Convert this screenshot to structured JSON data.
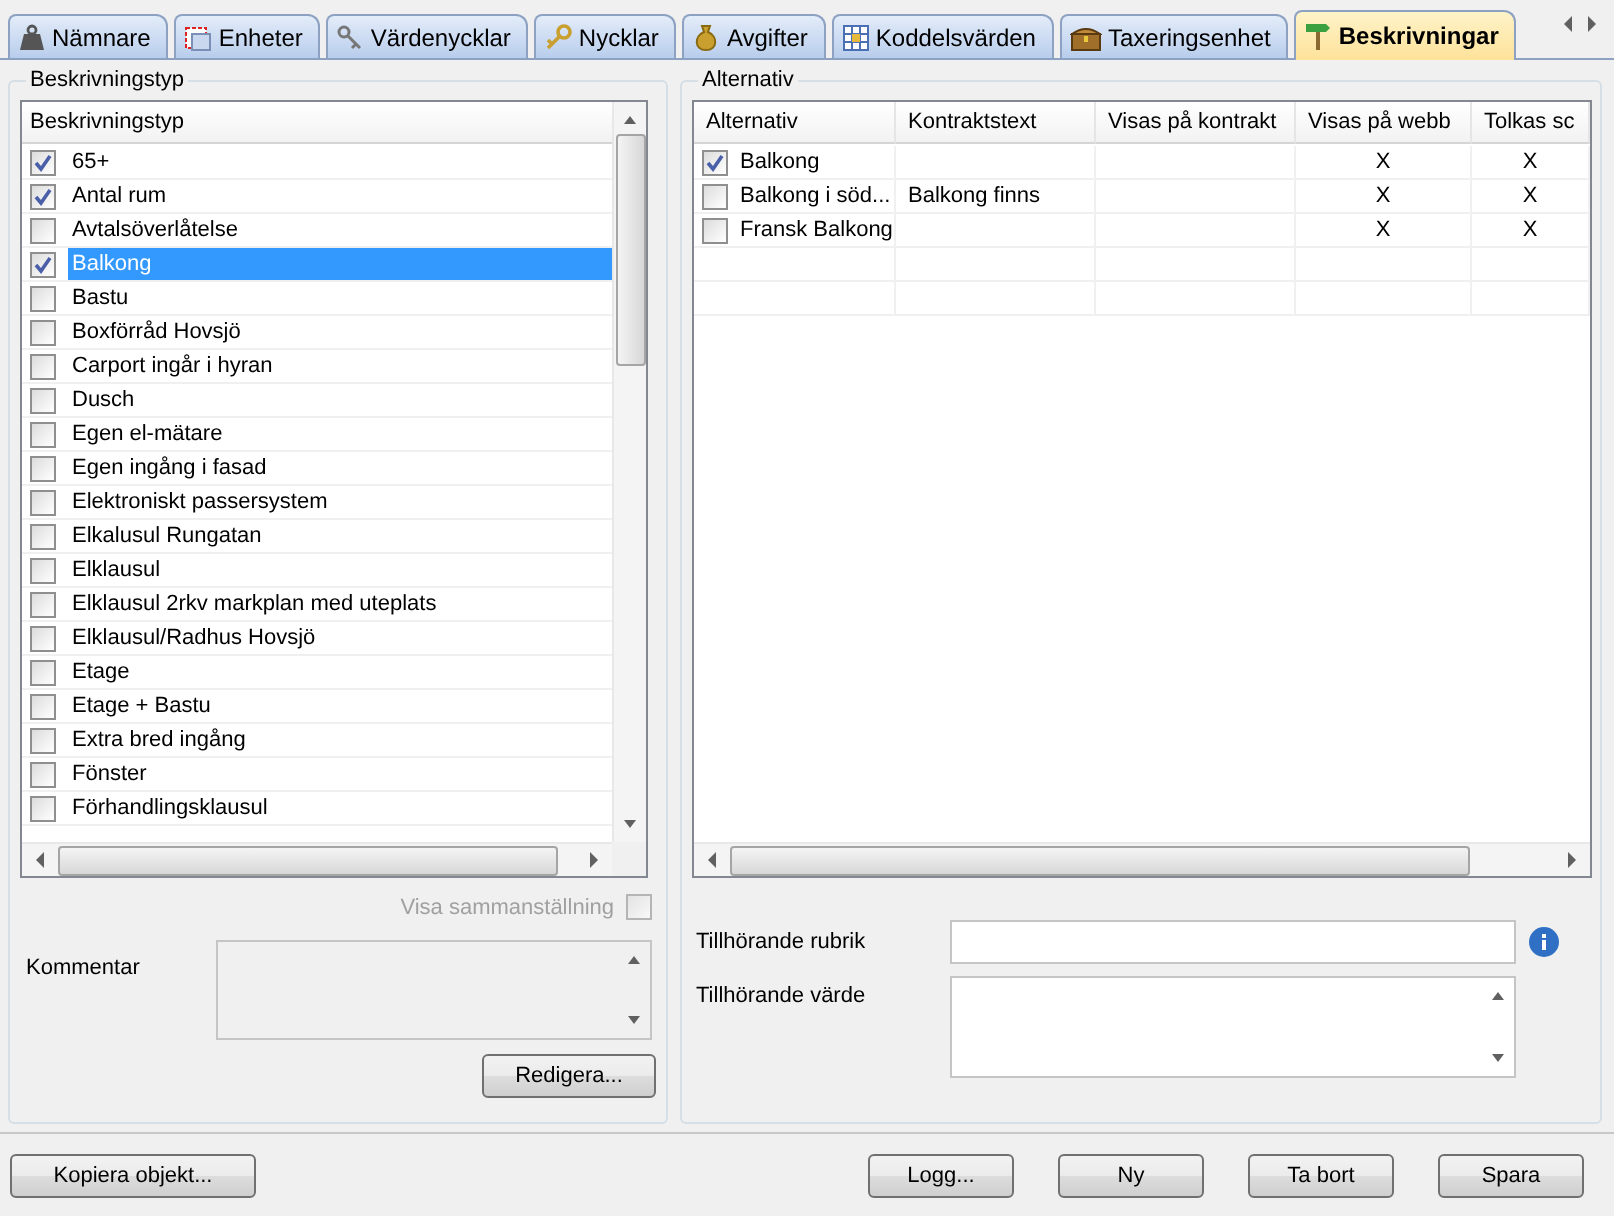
{
  "tabs": [
    {
      "label": "Nämnare",
      "selected": false
    },
    {
      "label": "Enheter",
      "selected": false
    },
    {
      "label": "Värdenycklar",
      "selected": false
    },
    {
      "label": "Nycklar",
      "selected": false
    },
    {
      "label": "Avgifter",
      "selected": false
    },
    {
      "label": "Koddelsvärden",
      "selected": false
    },
    {
      "label": "Taxeringsenhet",
      "selected": false
    },
    {
      "label": "Beskrivningar",
      "selected": true
    }
  ],
  "left_panel": {
    "title": "Beskrivningstyp",
    "list": {
      "header": "Beskrivningstyp",
      "items": [
        {
          "label": "65+",
          "checked": true,
          "selected": false
        },
        {
          "label": "Antal rum",
          "checked": true,
          "selected": false
        },
        {
          "label": "Avtalsöverlåtelse",
          "checked": false,
          "selected": false
        },
        {
          "label": "Balkong",
          "checked": true,
          "selected": true
        },
        {
          "label": "Bastu",
          "checked": false,
          "selected": false
        },
        {
          "label": "Boxförråd Hovsjö",
          "checked": false,
          "selected": false
        },
        {
          "label": "Carport ingår i hyran",
          "checked": false,
          "selected": false
        },
        {
          "label": "Dusch",
          "checked": false,
          "selected": false
        },
        {
          "label": "Egen el-mätare",
          "checked": false,
          "selected": false
        },
        {
          "label": "Egen ingång i fasad",
          "checked": false,
          "selected": false
        },
        {
          "label": "Elektroniskt passersystem",
          "checked": false,
          "selected": false
        },
        {
          "label": "Elkalusul Rungatan",
          "checked": false,
          "selected": false
        },
        {
          "label": "Elklausul",
          "checked": false,
          "selected": false
        },
        {
          "label": "Elklausul 2rkv markplan med uteplats",
          "checked": false,
          "selected": false
        },
        {
          "label": "Elklausul/Radhus Hovsjö",
          "checked": false,
          "selected": false
        },
        {
          "label": "Etage",
          "checked": false,
          "selected": false
        },
        {
          "label": "Etage + Bastu",
          "checked": false,
          "selected": false
        },
        {
          "label": "Extra bred ingång",
          "checked": false,
          "selected": false
        },
        {
          "label": "Fönster",
          "checked": false,
          "selected": false
        },
        {
          "label": "Förhandlingsklausul",
          "checked": false,
          "selected": false
        }
      ]
    },
    "show_summary": {
      "label": "Visa sammanställning",
      "checked": false,
      "disabled": true
    },
    "comment_label": "Kommentar",
    "edit_button": "Redigera..."
  },
  "right_panel": {
    "title": "Alternativ",
    "table": {
      "columns": [
        "Alternativ",
        "Kontraktstext",
        "Visas på kontrakt",
        "Visas på webb",
        "Tolkas sc"
      ],
      "rows": [
        {
          "alternativ": "Balkong",
          "checked": true,
          "visas_pa_webb": "X",
          "tolkas": "X"
        },
        {
          "alternativ": "Balkong i söd...",
          "checked": false,
          "kontraktstext": "Balkong finns",
          "visas_pa_webb": "X",
          "tolkas": "X"
        },
        {
          "alternativ": "Fransk Balkong",
          "checked": false,
          "visas_pa_webb": "X",
          "tolkas": "X"
        }
      ]
    },
    "heading_field": {
      "label": "Tillhörande rubrik"
    },
    "value_field": {
      "label": "Tillhörande värde"
    }
  },
  "buttons": {
    "copy": "Kopiera objekt...",
    "actions": [
      "Logg...",
      "Ny",
      "Ta bort",
      "Spara"
    ]
  }
}
